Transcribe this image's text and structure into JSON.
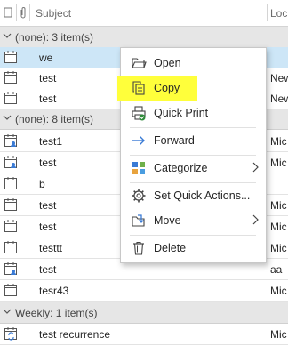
{
  "header": {
    "attach_icon": "paperclip-icon",
    "subject_label": "Subject",
    "location_label": "Loc"
  },
  "groups": [
    {
      "label": "(none): 3 item(s)"
    },
    {
      "label": "(none): 8 item(s)"
    },
    {
      "label": "Weekly: 1 item(s)"
    }
  ],
  "rows": [
    {
      "subject": "we",
      "location": ""
    },
    {
      "subject": "test",
      "location": "New"
    },
    {
      "subject": "test",
      "location": "New"
    },
    {
      "subject": "test1",
      "location": "Mic"
    },
    {
      "subject": "test",
      "location": "Mic"
    },
    {
      "subject": "b",
      "location": ""
    },
    {
      "subject": "test",
      "location": "Mic"
    },
    {
      "subject": "test",
      "location": "Mic"
    },
    {
      "subject": "testtt",
      "location": "Mic"
    },
    {
      "subject": "test",
      "location": "aa"
    },
    {
      "subject": "tesr43",
      "location": "Mic"
    },
    {
      "subject": "test recurrence",
      "location": "Mic"
    }
  ],
  "context_menu": {
    "items": [
      {
        "label": "Open",
        "icon": "folder-open-icon"
      },
      {
        "label": "Copy",
        "icon": "copy-icon",
        "highlight_color": "#ffff3b"
      },
      {
        "label": "Quick Print",
        "icon": "printer-icon"
      },
      {
        "label": "Forward",
        "icon": "arrow-right-icon"
      },
      {
        "label": "Categorize",
        "icon": "category-grid-icon"
      },
      {
        "label": "Set Quick Actions...",
        "icon": "gear-icon"
      },
      {
        "label": "Move",
        "icon": "move-to-folder-icon"
      },
      {
        "label": "Delete",
        "icon": "trash-icon"
      }
    ]
  },
  "colors": {
    "selected_row": "#cde6f7",
    "group_header": "#e6e6e6",
    "highlight": "#ffff3b"
  }
}
